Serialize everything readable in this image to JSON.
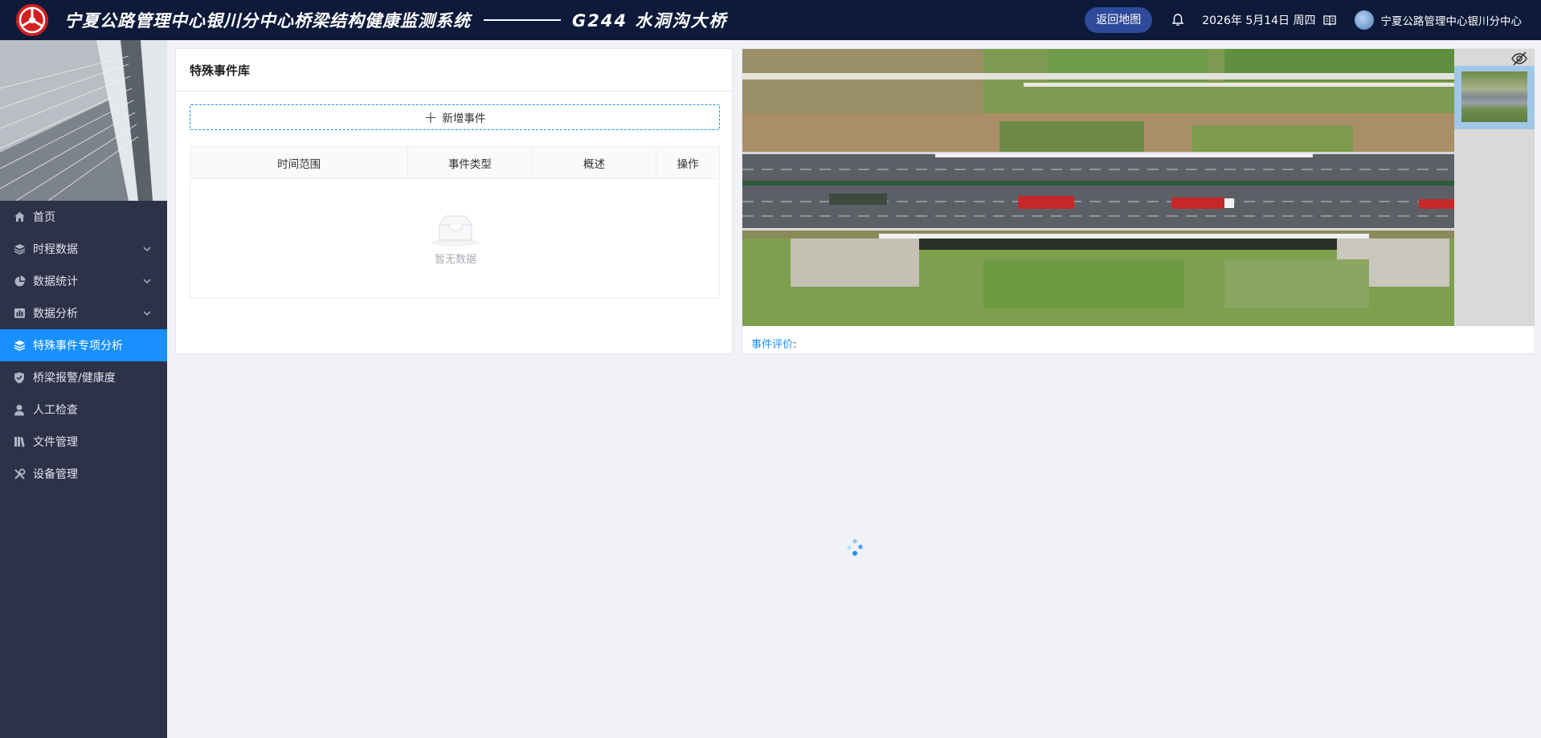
{
  "header": {
    "app_title": "宁夏公路管理中心银川分中心桥梁结构健康监测系统",
    "bridge_name": "G244  水洞沟大桥",
    "back_button": "返回地图",
    "date": "2026年 5月14日 周四",
    "user": "宁夏公路管理中心银川分中心"
  },
  "sidebar": {
    "items": [
      {
        "label": "首页",
        "icon": "home-icon",
        "has_submenu": false,
        "active": false
      },
      {
        "label": "时程数据",
        "icon": "layers-icon",
        "has_submenu": true,
        "active": false
      },
      {
        "label": "数据统计",
        "icon": "pie-chart-icon",
        "has_submenu": true,
        "active": false
      },
      {
        "label": "数据分析",
        "icon": "bar-chart-icon",
        "has_submenu": true,
        "active": false
      },
      {
        "label": "特殊事件专项分析",
        "icon": "layers-icon",
        "has_submenu": false,
        "active": true
      },
      {
        "label": "桥梁报警/健康度",
        "icon": "shield-icon",
        "has_submenu": false,
        "active": false
      },
      {
        "label": "人工检查",
        "icon": "inspector-icon",
        "has_submenu": false,
        "active": false
      },
      {
        "label": "文件管理",
        "icon": "books-icon",
        "has_submenu": false,
        "active": false
      },
      {
        "label": "设备管理",
        "icon": "tools-icon",
        "has_submenu": false,
        "active": false
      }
    ]
  },
  "events_panel": {
    "title": "特殊事件库",
    "add_button": "新增事件",
    "columns": [
      "时间范围",
      "事件类型",
      "概述",
      "操作"
    ],
    "empty_text": "暂无数据"
  },
  "media_panel": {
    "evaluation_label": "事件评价",
    "evaluation_colon": ":"
  },
  "colors": {
    "header_bg": "#0d1a3a",
    "sidebar_bg": "#2d3248",
    "accent": "#1890ff"
  }
}
